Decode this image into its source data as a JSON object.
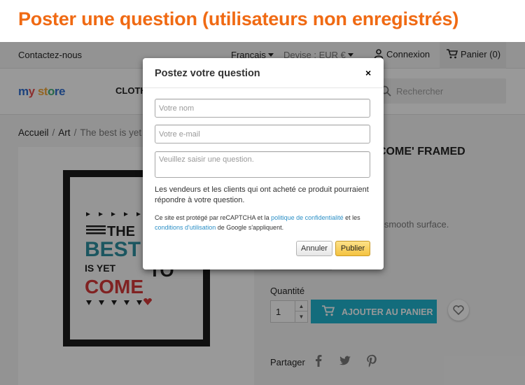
{
  "banner": {
    "title": "Poster une question (utilisateurs non enregistrés)",
    "color": "#f06a13"
  },
  "topnav": {
    "contact": "Contactez-nous",
    "language": "Français",
    "currency": "Devise : EUR €",
    "login": "Connexion",
    "cart": "Panier (0)"
  },
  "header": {
    "logo": {
      "part1": "m",
      "part2": "y",
      "part3": "st",
      "part4": "o",
      "part5": "re"
    },
    "menu_clothes": "CLOTH",
    "search_placeholder": "Rechercher"
  },
  "breadcrumb": {
    "home": "Accueil",
    "art": "Art",
    "current": "The best is yet"
  },
  "product": {
    "title_partial": "COME' FRAMED",
    "description_partial": "d smooth surface.",
    "quantity_label": "Quantité",
    "quantity_value": "1",
    "add_to_cart": "AJOUTER AU PANIER",
    "share_label": "Partager",
    "accent_color": "#21b4cf"
  },
  "poster": {
    "line1": "THE",
    "line2": "BEST",
    "line3": "IS YET",
    "line4": "TO",
    "line5": "COME"
  },
  "modal": {
    "title": "Postez votre question",
    "close": "×",
    "name_placeholder": "Votre nom",
    "email_placeholder": "Votre e-mail",
    "question_placeholder": "Veuillez saisir une question.",
    "help_text": "Les vendeurs et les clients qui ont acheté ce produit pourraient répondre à votre question.",
    "captcha": {
      "pre": "Ce site est protégé par reCAPTCHA et la ",
      "privacy_link": "politique de confidentialité",
      "mid": " et les ",
      "terms_link": "conditions d'utilisation",
      "post": " de Google s'appliquent."
    },
    "cancel": "Annuler",
    "submit": "Publier"
  }
}
